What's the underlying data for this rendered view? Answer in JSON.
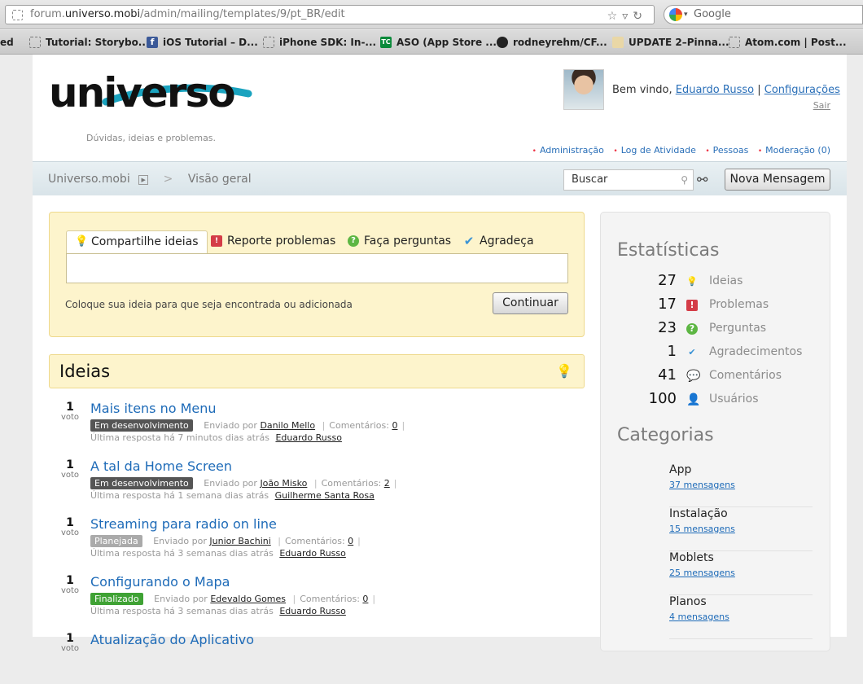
{
  "browser": {
    "url_prefix": "forum.",
    "url_host": "universo.mobi",
    "url_path": "/admin/mailing/templates/9/pt_BR/edit",
    "search_placeholder": "Google",
    "bookmarks": [
      {
        "label": "ed",
        "icon": "none"
      },
      {
        "label": "Tutorial: Storybo...",
        "icon": "page"
      },
      {
        "label": "iOS Tutorial – D...",
        "icon": "facebook"
      },
      {
        "label": "iPhone SDK: In-...",
        "icon": "page"
      },
      {
        "label": "ASO (App Store ...",
        "icon": "techcrunch"
      },
      {
        "label": "rodneyrehm/CF...",
        "icon": "github"
      },
      {
        "label": "UPDATE 2–Pinna...",
        "icon": "page"
      },
      {
        "label": "Atom.com | Post...",
        "icon": "page"
      }
    ]
  },
  "header": {
    "logo_text": "universo",
    "tagline": "Dúvidas, ideias e problemas.",
    "welcome_prefix": "Bem vindo,",
    "user_name": "Eduardo Russo",
    "separator": "|",
    "settings_label": "Configurações",
    "logout_label": "Sair",
    "links": [
      "Administração",
      "Log de Atividade",
      "Pessoas",
      "Moderação (0)"
    ]
  },
  "nav": {
    "home": "Universo.mobi",
    "sep": ">",
    "current": "Visão geral",
    "search_value": "Buscar",
    "new_message": "Nova Mensagem"
  },
  "share": {
    "tabs": [
      "Compartilhe ideias",
      "Reporte problemas",
      "Faça perguntas",
      "Agradeça"
    ],
    "hint": "Coloque sua ideia para que seja encontrada ou adicionada",
    "continue": "Continuar"
  },
  "ideas": {
    "title": "Ideias",
    "vote_label": "voto",
    "sent_by": "Enviado por",
    "comments": "Comentários:",
    "items": [
      {
        "votes": "1",
        "title": "Mais itens no Menu",
        "status": "Em desenvolvimento",
        "status_color": "#555555",
        "author": "Danilo Mello",
        "comments": "0",
        "last": "Última resposta há 7 minutos dias atrás",
        "last_user": "Eduardo Russo"
      },
      {
        "votes": "1",
        "title": "A tal da Home Screen",
        "status": "Em desenvolvimento",
        "status_color": "#555555",
        "author": "João Misko",
        "comments": "2",
        "last": "Última resposta há 1 semana dias atrás",
        "last_user": "Guilherme Santa Rosa"
      },
      {
        "votes": "1",
        "title": "Streaming para radio on line",
        "status": "Planejada",
        "status_color": "#aaaaaa",
        "author": "Junior Bachini",
        "comments": "0",
        "last": "Última resposta há 3 semanas dias atrás",
        "last_user": "Eduardo Russo"
      },
      {
        "votes": "1",
        "title": "Configurando o Mapa",
        "status": "Finalizado",
        "status_color": "#3fa234",
        "author": "Edevaldo Gomes",
        "comments": "0",
        "last": "Última resposta há 3 semanas dias atrás",
        "last_user": "Eduardo Russo"
      },
      {
        "votes": "1",
        "title": "Atualização do Aplicativo",
        "status": "",
        "status_color": "#555555",
        "author": "",
        "comments": "",
        "last": "",
        "last_user": ""
      }
    ]
  },
  "stats": {
    "title": "Estatísticas",
    "items": [
      {
        "value": "27",
        "label": "Ideias",
        "icon": "lightbulb-icon"
      },
      {
        "value": "17",
        "label": "Problemas",
        "icon": "problem-icon"
      },
      {
        "value": "23",
        "label": "Perguntas",
        "icon": "question-icon"
      },
      {
        "value": "1",
        "label": "Agradecimentos",
        "icon": "checkmark-icon"
      },
      {
        "value": "41",
        "label": "Comentários",
        "icon": "comment-icon"
      },
      {
        "value": "100",
        "label": "Usuários",
        "icon": "user-icon"
      }
    ]
  },
  "categories": {
    "title": "Categorias",
    "items": [
      {
        "name": "App",
        "count": "37 mensagens"
      },
      {
        "name": "Instalação",
        "count": "15 mensagens"
      },
      {
        "name": "Moblets",
        "count": "25 mensagens"
      },
      {
        "name": "Planos",
        "count": "4 mensagens"
      }
    ]
  },
  "colors": {
    "accent": "#1e6bb8",
    "logo_teal": "#1aa3bf",
    "panel_yellow": "#fdf4cc"
  }
}
